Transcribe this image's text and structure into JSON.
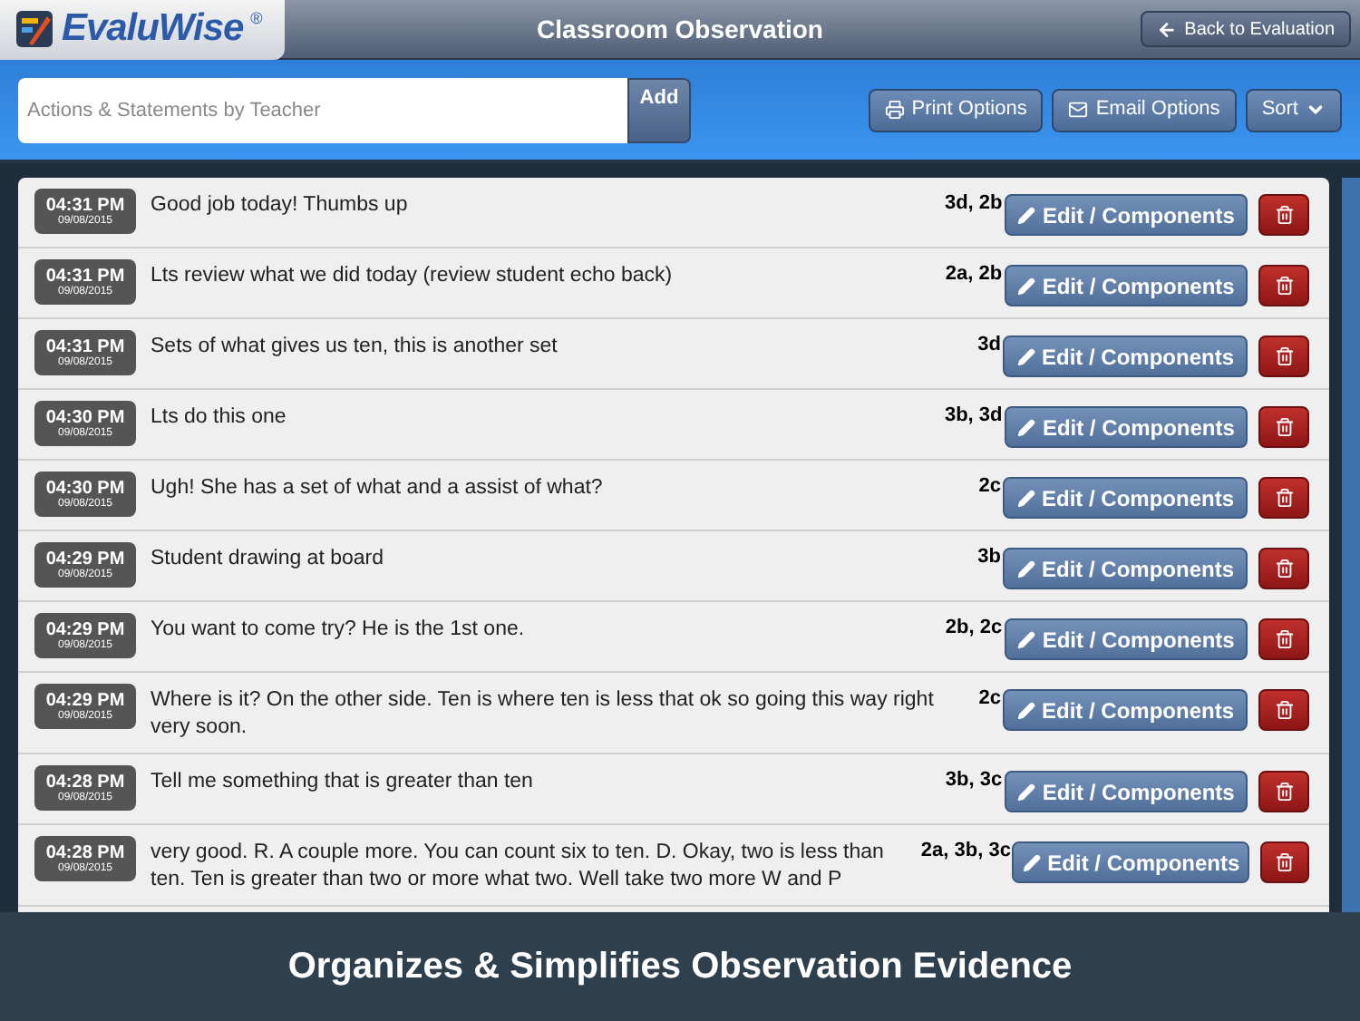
{
  "header": {
    "logo": "EvaluWise",
    "trademark": "®",
    "title": "Classroom Observation",
    "back_button": "Back to Evaluation"
  },
  "toolbar": {
    "input": {
      "placeholder": "Actions & Statements by Teacher"
    },
    "add_button": "Add",
    "print_button": "Print Options",
    "email_button": "Email Options",
    "sort_button": "Sort"
  },
  "entries": [
    {
      "time": "04:31 PM",
      "date": "09/08/2015",
      "text": "Good job today! Thumbs up",
      "components": "3d, 2b",
      "edit": "Edit / Components"
    },
    {
      "time": "04:31 PM",
      "date": "09/08/2015",
      "text": "Lts review what we did today (review student echo back)",
      "components": "2a, 2b",
      "edit": "Edit / Components"
    },
    {
      "time": "04:31 PM",
      "date": "09/08/2015",
      "text": "Sets of what gives us ten, this is another set",
      "components": "3d",
      "edit": "Edit / Components"
    },
    {
      "time": "04:30 PM",
      "date": "09/08/2015",
      "text": "Lts do this one",
      "components": "3b, 3d",
      "edit": "Edit / Components"
    },
    {
      "time": "04:30 PM",
      "date": "09/08/2015",
      "text": "Ugh! She has a set of what and a assist of what?",
      "components": "2c",
      "edit": "Edit / Components"
    },
    {
      "time": "04:29 PM",
      "date": "09/08/2015",
      "text": "Student drawing at board",
      "components": "3b",
      "edit": "Edit / Components"
    },
    {
      "time": "04:29 PM",
      "date": "09/08/2015",
      "text": "You want to come try? He is the 1st one.",
      "components": "2b, 2c",
      "edit": "Edit / Components"
    },
    {
      "time": "04:29 PM",
      "date": "09/08/2015",
      "text": "Where is it? On the other side. Ten is where ten is less that ok so going this way right very soon.",
      "components": "2c",
      "edit": "Edit / Components"
    },
    {
      "time": "04:28 PM",
      "date": "09/08/2015",
      "text": "Tell me something that is greater than ten",
      "components": "3b, 3c",
      "edit": "Edit / Components"
    },
    {
      "time": "04:28 PM",
      "date": "09/08/2015",
      "text": "very good. R. A couple more. You can count six to ten. D. Okay, two is less than ten. Ten is greater than two or more what two. Well take two more W and P",
      "components": "2a, 3b, 3c",
      "edit": "Edit / Components"
    }
  ],
  "caption": "Organizes & Simplifies Observation Evidence"
}
